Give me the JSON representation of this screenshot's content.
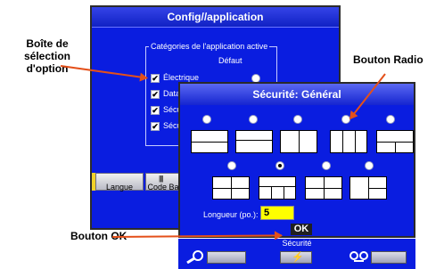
{
  "callouts": {
    "option_box": "Boîte de\nsélection\nd'option",
    "radio_button": "Bouton Radio",
    "ok_button": "Bouton OK"
  },
  "back_window": {
    "title": "Config//application",
    "group_label": "Catégories de l'application active",
    "default_column": "Défaut",
    "items": [
      {
        "label": "Électrique",
        "checked": true
      },
      {
        "label": "Datal",
        "checked": true
      },
      {
        "label": "Sécu",
        "checked": true
      },
      {
        "label": "Sécu",
        "checked": true
      }
    ],
    "tabs": [
      "Langue",
      "Code Ba"
    ]
  },
  "dialog": {
    "title": "Sécurité: Général",
    "length_label": "Longueur (po.):",
    "length_value": "5",
    "ok_label": "OK",
    "selected_layout_index": 6
  },
  "bottom_bar": {
    "status": "Sécurité",
    "icons": [
      "search-icon",
      "lightning-icon",
      "tape-icon"
    ]
  },
  "colors": {
    "screen_blue": "#0a1de0",
    "arrow_orange": "#e4501a",
    "input_yellow": "#ffff00"
  }
}
